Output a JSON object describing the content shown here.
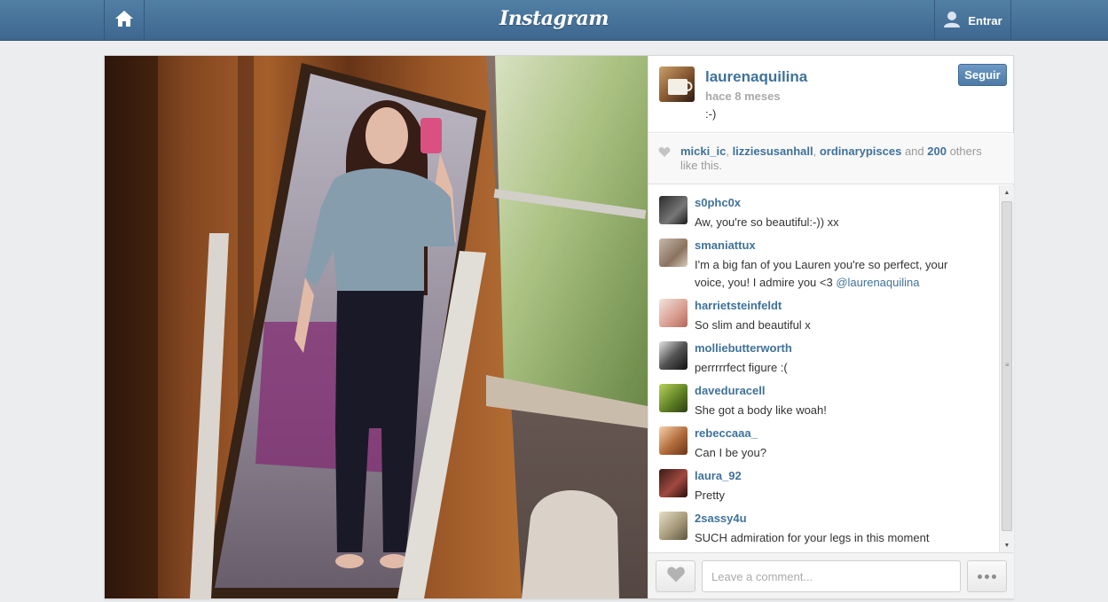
{
  "header": {
    "logo": "Instagram",
    "login_label": "Entrar",
    "home_icon": "home-icon",
    "user_icon": "user-icon"
  },
  "post": {
    "owner": "laurenaquilina",
    "time": "hace 8 meses",
    "caption": ":-)",
    "follow_label": "Seguir",
    "likes": {
      "users": [
        "micki_ic",
        "lizziesusanhall",
        "ordinarypisces"
      ],
      "sep1": ", ",
      "sep2": ", ",
      "and": " and ",
      "count": "200",
      "suffix": " others like this."
    }
  },
  "comments": [
    {
      "user": "s0phc0x",
      "text": "Aw, you're so beautiful:-)) xx"
    },
    {
      "user": "smaniattux",
      "text": "I'm a big fan of you Lauren you're so perfect, your voice, you! I admire you <3 ",
      "mention": "@laurenaquilina"
    },
    {
      "user": "harrietsteinfeldt",
      "text": "So slim and beautiful x"
    },
    {
      "user": "molliebutterworth",
      "text": "perrrrrfect figure :("
    },
    {
      "user": "daveduracell",
      "text": "She got a body like woah!"
    },
    {
      "user": "rebeccaaa_",
      "text": "Can I be you?"
    },
    {
      "user": "laura_92",
      "text": "Pretty"
    },
    {
      "user": "2sassy4u",
      "text": "SUCH admiration for your legs in this moment"
    }
  ],
  "footer": {
    "comment_placeholder": "Leave a comment..."
  },
  "colors": {
    "brand_blue": "#3f729b",
    "topbar": "#517fa4"
  }
}
